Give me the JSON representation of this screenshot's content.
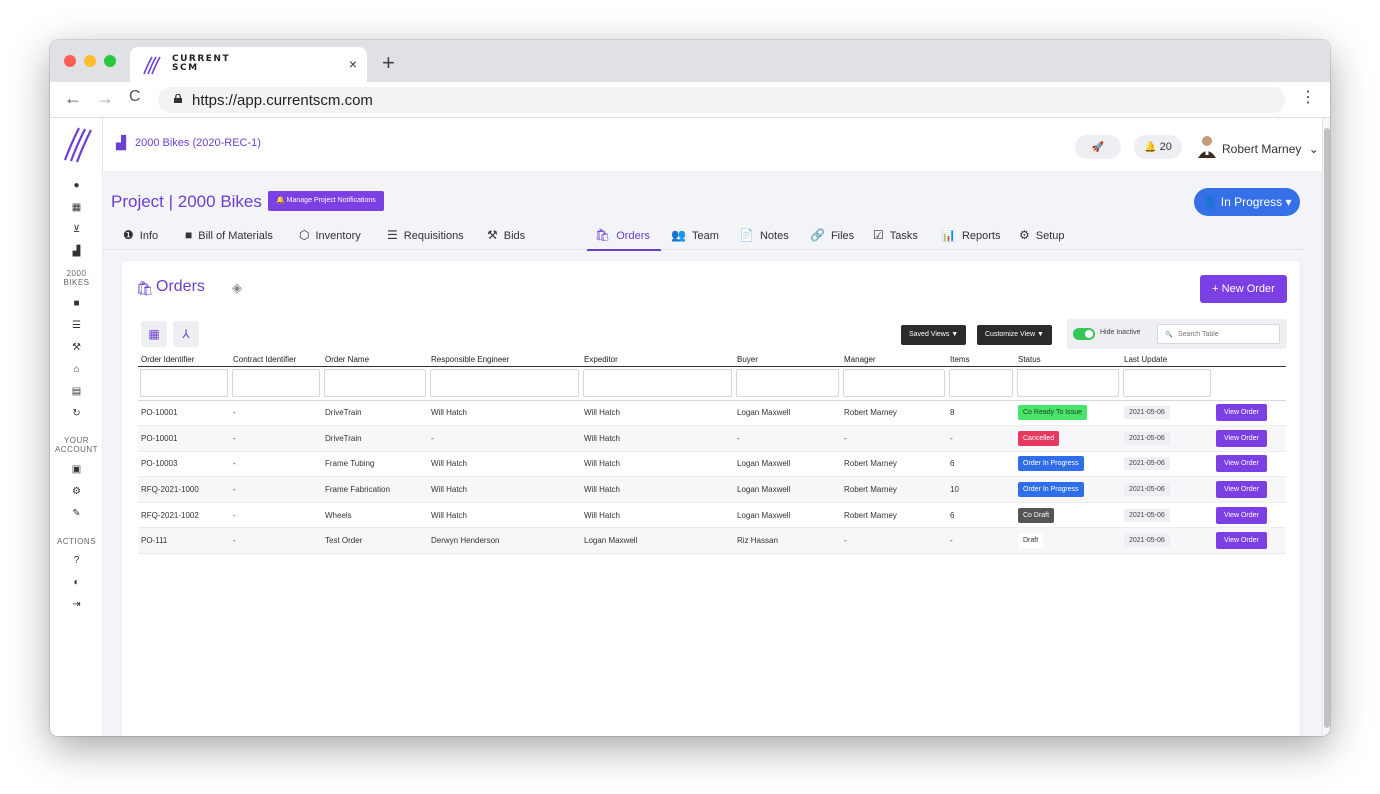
{
  "browser": {
    "tab_brand_line1": "CURRENT",
    "tab_brand_line2": "SCM",
    "tab_close": "×",
    "new_tab": "+",
    "url": "https://app.currentscm.com",
    "back": "←",
    "forward": "→",
    "reload": "C",
    "menu": "⋮"
  },
  "topbar": {
    "project_link": "2000 Bikes (2020-REC-1)",
    "notifications_count": "20",
    "user_name": "Robert Marney",
    "user_chevron": "⌄",
    "rocket": "🚀",
    "bell": "🔔"
  },
  "sidebar": {
    "project_label_line1": "2000",
    "project_label_line2": "BIKES",
    "account_label_line1": "YOUR",
    "account_label_line2": "ACCOUNT",
    "actions_label": "ACTIONS"
  },
  "header": {
    "title": "Project | 2000 Bikes",
    "manage_notifications": "🔔 Manage Project Notifications",
    "status": "👤 In Progress ▾"
  },
  "tabs": [
    {
      "label": "Info",
      "icon": "❶"
    },
    {
      "label": "Bill of Materials",
      "icon": "■"
    },
    {
      "label": "Inventory",
      "icon": "⬡"
    },
    {
      "label": "Requisitions",
      "icon": "☰"
    },
    {
      "label": "Bids",
      "icon": "⚒"
    },
    {
      "label": "Orders",
      "icon": "🛍"
    },
    {
      "label": "Team",
      "icon": "👥"
    },
    {
      "label": "Notes",
      "icon": "📄"
    },
    {
      "label": "Files",
      "icon": "🔗"
    },
    {
      "label": "Tasks",
      "icon": "☑"
    },
    {
      "label": "Reports",
      "icon": "📊"
    },
    {
      "label": "Setup",
      "icon": "⚙"
    }
  ],
  "orders": {
    "title": "Orders",
    "new_order": "+ New Order",
    "saved_views": "Saved Views ▼",
    "customize_view": "Customize View ▼",
    "hide_inactive": "Hide Inactive",
    "search_placeholder": "Search Table",
    "columns": [
      "Order Identifier",
      "Contract Identifier",
      "Order Name",
      "Responsible Engineer",
      "Expeditor",
      "Buyer",
      "Manager",
      "Items",
      "Status",
      "Last Update",
      ""
    ],
    "rows": [
      {
        "id": "PO-10001",
        "contract": "-",
        "name": "DriveTrain",
        "engineer": "Will Hatch",
        "expeditor": "Will Hatch",
        "buyer": "Logan Maxwell",
        "manager": "Robert Marney",
        "items": "8",
        "status": "Co Ready To Issue",
        "status_kind": "ready",
        "updated": "2021-05-06",
        "action": "View Order"
      },
      {
        "id": "PO-10001",
        "contract": "-",
        "name": "DriveTrain",
        "engineer": "-",
        "expeditor": "Will Hatch",
        "buyer": "-",
        "manager": "-",
        "items": "-",
        "status": "Cancelled",
        "status_kind": "cancel",
        "updated": "2021-05-06",
        "action": "View Order"
      },
      {
        "id": "PO-10003",
        "contract": "-",
        "name": "Frame Tubing",
        "engineer": "Will Hatch",
        "expeditor": "Will Hatch",
        "buyer": "Logan Maxwell",
        "manager": "Robert Marney",
        "items": "6",
        "status": "Order In Progress",
        "status_kind": "prog",
        "updated": "2021-05-06",
        "action": "View Order"
      },
      {
        "id": "RFQ-2021-1000",
        "contract": "-",
        "name": "Frame Fabrication",
        "engineer": "Will Hatch",
        "expeditor": "Will Hatch",
        "buyer": "Logan Maxwell",
        "manager": "Robert Marney",
        "items": "10",
        "status": "Order In Progress",
        "status_kind": "prog",
        "updated": "2021-05-06",
        "action": "View Order"
      },
      {
        "id": "RFQ-2021-1002",
        "contract": "-",
        "name": "Wheels",
        "engineer": "Will Hatch",
        "expeditor": "Will Hatch",
        "buyer": "Logan Maxwell",
        "manager": "Robert Marney",
        "items": "6",
        "status": "Co Draft",
        "status_kind": "draftco",
        "updated": "2021-05-06",
        "action": "View Order"
      },
      {
        "id": "PO-111",
        "contract": "-",
        "name": "Test Order",
        "engineer": "Derwyn Henderson",
        "expeditor": "Logan Maxwell",
        "buyer": "Riz Hassan",
        "manager": "-",
        "items": "-",
        "status": "Draft",
        "status_kind": "draft",
        "updated": "2021-05-06",
        "action": "View Order"
      }
    ]
  },
  "colors": {
    "brand": "#6d3fcf",
    "button": "#7b3fe4",
    "status_blue": "#3670e8",
    "ready_green": "#48e56a",
    "cancel_red": "#e8385f"
  }
}
